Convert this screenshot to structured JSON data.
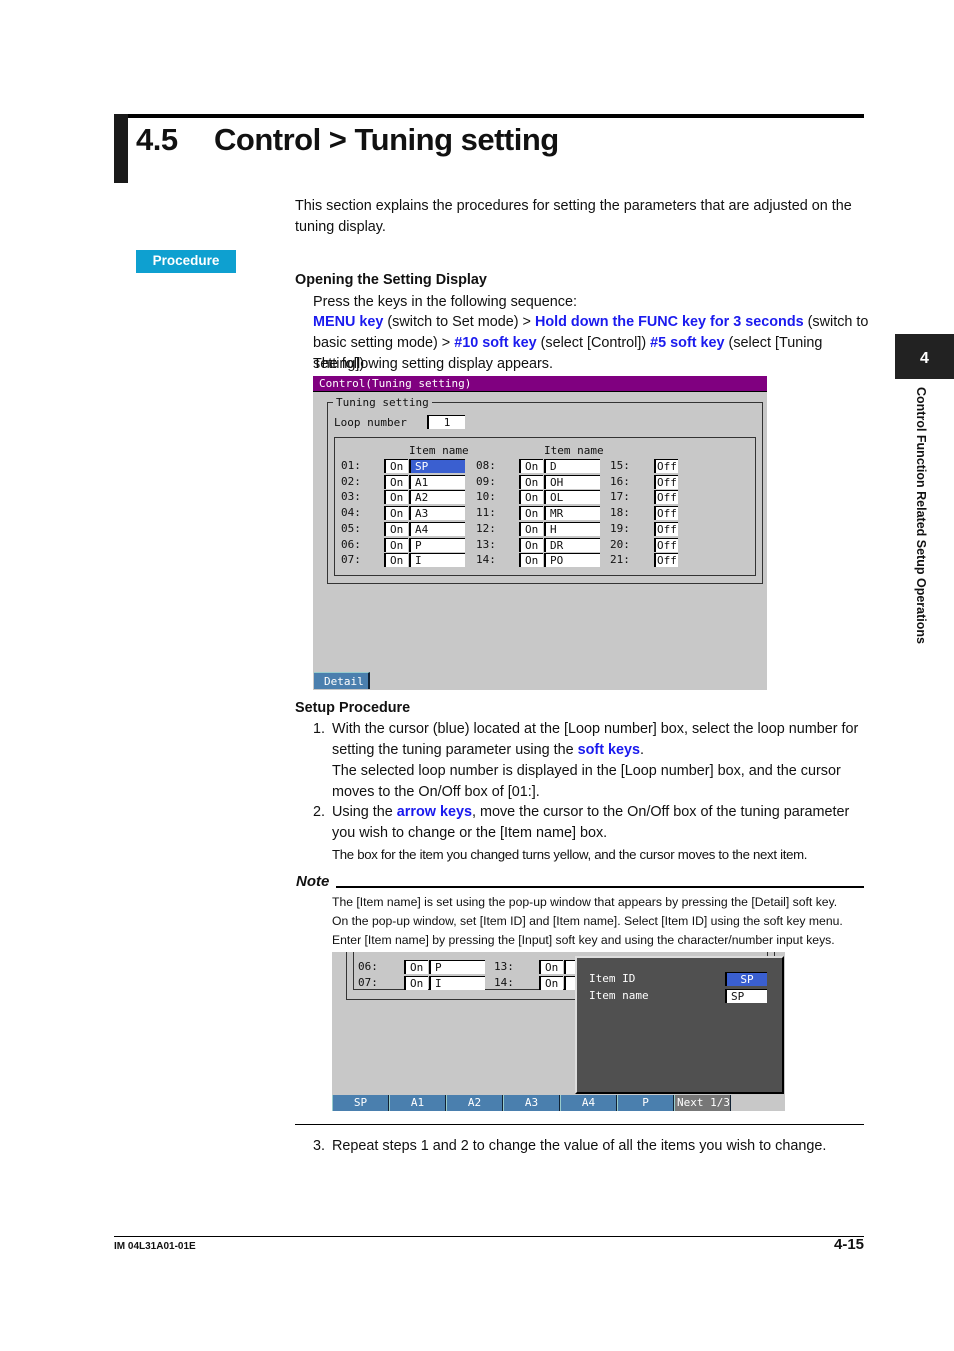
{
  "header": {
    "section_number": "4.5",
    "section_title": "Control > Tuning setting"
  },
  "intro": "This section explains the procedures for setting the parameters that are adjusted on the tuning display.",
  "procedure_badge": "Procedure",
  "opening": {
    "heading": "Opening the Setting Display",
    "line1": "Press the keys in the following sequence:",
    "seq": [
      {
        "t": "MENU key",
        "b": true
      },
      {
        "t": " (switch to Set mode) > ",
        "b": false
      },
      {
        "t": "Hold down the FUNC key for 3 seconds",
        "b": true
      },
      {
        "t": " (switch to basic setting mode) > ",
        "b": false
      },
      {
        "t": "#10 soft key",
        "b": true
      },
      {
        "t": " (select [Control]) ",
        "b": false
      },
      {
        "t": "#5 soft key",
        "b": true
      },
      {
        "t": " (select [Tuning setting])",
        "b": false
      }
    ],
    "line_after": "The following setting display appears."
  },
  "screen1": {
    "title": "Control(Tuning setting)",
    "group_label": "Tuning setting",
    "loop_label": "Loop number",
    "loop_value": "1",
    "item_name_header": "Item name",
    "col1": [
      {
        "no": "01:",
        "state": "On",
        "name": "SP"
      },
      {
        "no": "02:",
        "state": "On",
        "name": "A1"
      },
      {
        "no": "03:",
        "state": "On",
        "name": "A2"
      },
      {
        "no": "04:",
        "state": "On",
        "name": "A3"
      },
      {
        "no": "05:",
        "state": "On",
        "name": "A4"
      },
      {
        "no": "06:",
        "state": "On",
        "name": "P"
      },
      {
        "no": "07:",
        "state": "On",
        "name": "I"
      }
    ],
    "col2": [
      {
        "no": "08:",
        "state": "On",
        "name": "D"
      },
      {
        "no": "09:",
        "state": "On",
        "name": "OH"
      },
      {
        "no": "10:",
        "state": "On",
        "name": "OL"
      },
      {
        "no": "11:",
        "state": "On",
        "name": "MR"
      },
      {
        "no": "12:",
        "state": "On",
        "name": "H"
      },
      {
        "no": "13:",
        "state": "On",
        "name": "DR"
      },
      {
        "no": "14:",
        "state": "On",
        "name": "PO"
      }
    ],
    "col3": [
      {
        "no": "15:",
        "state": "Off"
      },
      {
        "no": "16:",
        "state": "Off"
      },
      {
        "no": "17:",
        "state": "Off"
      },
      {
        "no": "18:",
        "state": "Off"
      },
      {
        "no": "19:",
        "state": "Off"
      },
      {
        "no": "20:",
        "state": "Off"
      },
      {
        "no": "21:",
        "state": "Off"
      }
    ],
    "detail_button": "Detail"
  },
  "setup": {
    "heading": "Setup Procedure",
    "step1_num": "1.",
    "step1_a": "With the cursor (blue) located at the [Loop number] box, select the loop number for setting the tuning parameter using the ",
    "step1_link": "soft keys",
    "step1_b": ".",
    "step1_c": "The selected loop number is displayed in the [Loop number] box, and the cursor moves to the On/Off box of [01:].",
    "step2_num": "2.",
    "step2_a": "Using the ",
    "step2_link": "arrow keys",
    "step2_b": ", move the cursor to the On/Off box of the tuning parameter you wish to change or the [Item name] box.",
    "step2_c": "The box for the item you changed turns yellow, and the cursor moves to the next item.",
    "step3_num": "3.",
    "step3": "Repeat steps 1 and 2 to change the value of all the items you wish to change."
  },
  "note": {
    "title": "Note",
    "lines": [
      "The [Item name] is set using the pop-up window that appears by pressing the [Detail] soft key.",
      "On the pop-up window, set [Item ID] and [Item name].  Select [Item ID] using the soft key menu.",
      "Enter [Item name] by pressing the [Input] soft key and using the character/number input keys."
    ]
  },
  "screen2": {
    "rows": [
      {
        "no": "06:",
        "state": "On",
        "name": "P",
        "no2": "13:",
        "state2": "On"
      },
      {
        "no": "07:",
        "state": "On",
        "name": "I",
        "no2": "14:",
        "state2": "On"
      }
    ],
    "popup": {
      "id_label": "Item ID",
      "name_label": "Item name",
      "id_value": "SP",
      "name_value": "SP"
    },
    "softkeys": [
      "SP",
      "A1",
      "A2",
      "A3",
      "A4",
      "P",
      "Next 1/3"
    ]
  },
  "side_tab": {
    "number": "4",
    "text": "Control Function Related Setup Operations"
  },
  "footer": {
    "doc_id": "IM 04L31A01-01E",
    "page": "4-15"
  }
}
